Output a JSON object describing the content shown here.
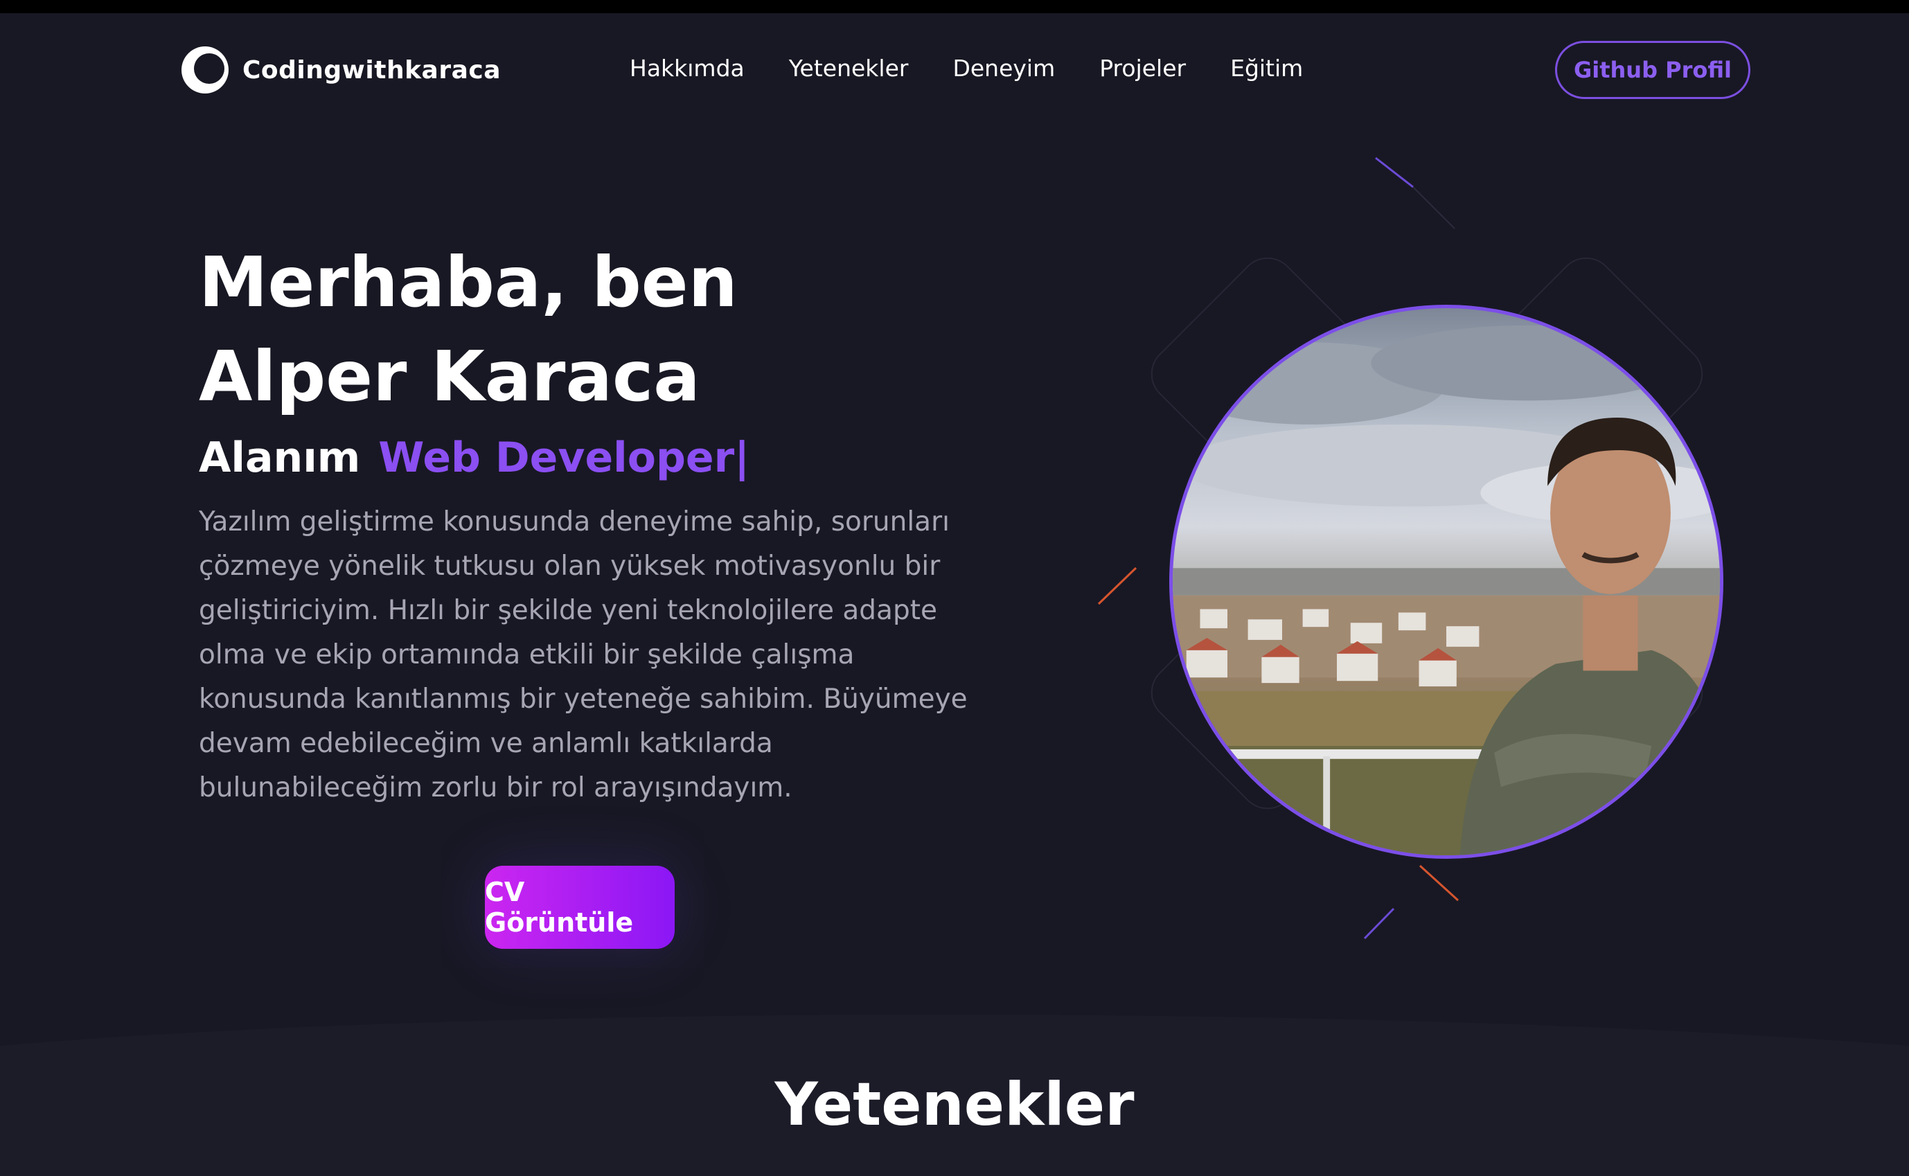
{
  "nav": {
    "brand": "Codingwithkaraca",
    "brand_icon": "circle-logo-icon",
    "items": [
      {
        "label": "Hakkımda"
      },
      {
        "label": "Yetenekler"
      },
      {
        "label": "Deneyim"
      },
      {
        "label": "Projeler"
      },
      {
        "label": "Eğitim"
      }
    ],
    "github_button": "Github Profil"
  },
  "hero": {
    "title_line1": "Merhaba, ben",
    "title_line2": "Alper Karaca",
    "role_prefix": "Alanım",
    "role": "Web Developer|",
    "description": "Yazılım geliştirme konusunda deneyime sahip, sorunları çözmeye yönelik tutkusu olan yüksek motivasyonlu bir geliştiriciyim. Hızlı bir şekilde yeni teknolojilere adapte olma ve ekip ortamında etkili bir şekilde çalışma konusunda kanıtlanmış bir yeteneğe sahibim. Büyümeye devam edebileceğim ve anlamlı katkılarda bulunabileceğim zorlu bir rol arayışındayım.",
    "cv_button": "CV Görüntüle"
  },
  "section": {
    "title": "Yetenekler"
  },
  "colors": {
    "background": "#181824",
    "accent": "#8b4ff2",
    "button_gradient_start": "#cc26f0",
    "button_gradient_end": "#8b17f5"
  }
}
